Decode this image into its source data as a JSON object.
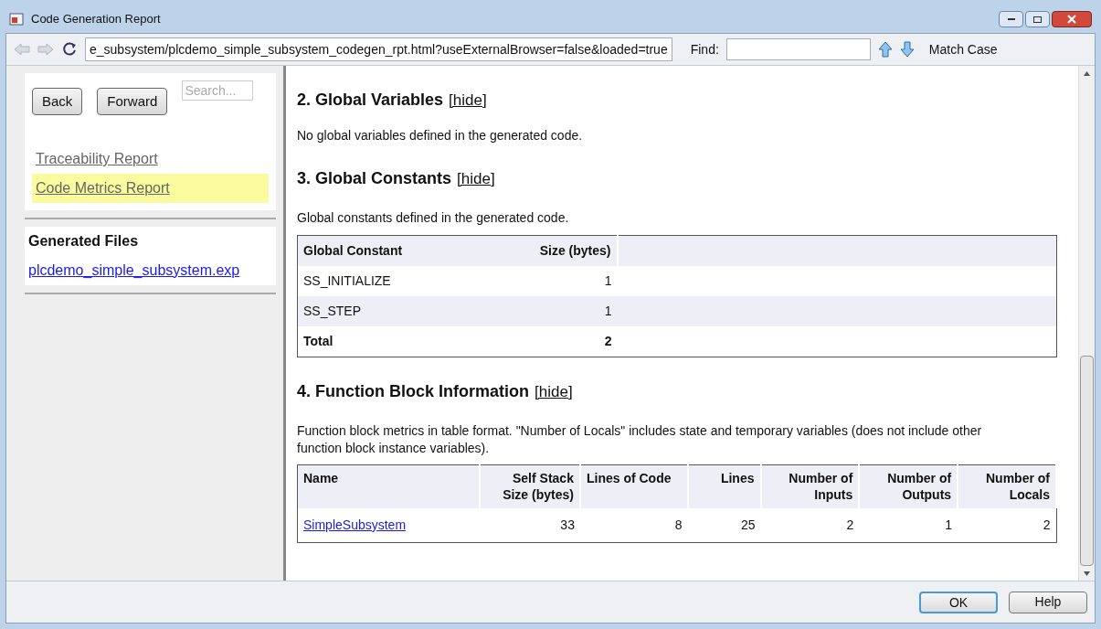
{
  "window": {
    "title": "Code Generation Report"
  },
  "toolbar": {
    "address": "e_subsystem/plcdemo_simple_subsystem_codegen_rpt.html?useExternalBrowser=false&loaded=true",
    "find_label": "Find:",
    "match_case": "Match Case"
  },
  "sidebar": {
    "buttons": [
      "Back",
      "Forward"
    ],
    "search": {
      "placeholder": "Search..."
    },
    "items": [
      {
        "label": "Traceability Report",
        "selected": false
      },
      {
        "label": "Code Metrics Report",
        "selected": true
      }
    ],
    "files_heading": "Generated Files",
    "files": [
      "plcdemo_simple_subsystem.exp"
    ]
  },
  "sections": [
    {
      "heading": "2. Global Variables",
      "hide": "[hide]",
      "text": "No global variables defined in the generated code."
    },
    {
      "heading": "3. Global Constants",
      "hide": "[hide]",
      "text": "Global constants defined in the generated code.",
      "table": {
        "kind": "constants",
        "columns": [
          "Global Constant",
          "Size (bytes)"
        ],
        "rows": [
          [
            "SS_INITIALIZE",
            "1"
          ],
          [
            "SS_STEP",
            "1"
          ]
        ],
        "total": [
          "Total",
          "2"
        ]
      }
    },
    {
      "heading": "4. Function Block Information",
      "hide": "[hide]",
      "text": "Function block metrics in table format. \"Number of Locals\" includes state and temporary variables (does not include other function block instance variables).",
      "table": {
        "kind": "blocks",
        "columns": [
          "Name",
          "Self Stack Size (bytes)",
          "Lines of Code",
          "Lines",
          "Number of Inputs",
          "Number of Outputs",
          "Number of Locals"
        ],
        "rows": [
          [
            "SimpleSubsystem",
            "33",
            "8",
            "25",
            "2",
            "1",
            "2"
          ]
        ]
      }
    }
  ],
  "buttons": [
    "OK",
    "Help"
  ]
}
